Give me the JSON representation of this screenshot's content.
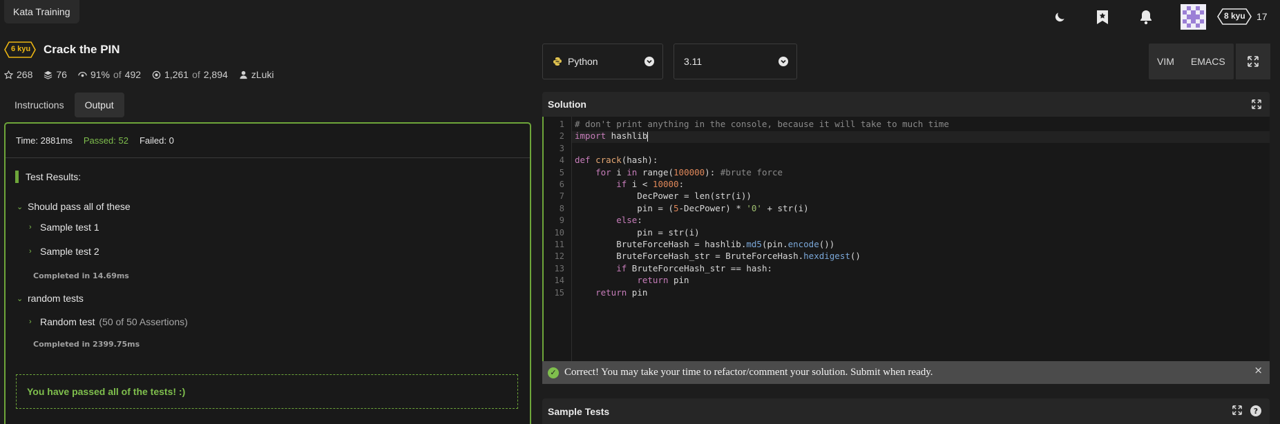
{
  "topbar": {
    "kata_training": "Kata Training",
    "rank": "8 kyu",
    "honor": "17"
  },
  "kata": {
    "kyu": "6 kyu",
    "title": "Crack the PIN",
    "stats": {
      "stars": "268",
      "collections": "76",
      "satisfaction": "91%",
      "satisfaction_of": "of",
      "votes": "492",
      "completed": "1,261",
      "completed_of": "of",
      "attempted": "2,894",
      "author": "zLuki"
    }
  },
  "tabs": [
    "Instructions",
    "Output"
  ],
  "output": {
    "time": "Time: 2881ms",
    "passed": "Passed: 52",
    "failed": "Failed: 0",
    "results_heading": "Test Results:",
    "group1": "Should pass all of these",
    "test1": "Sample test 1",
    "test2": "Sample test 2",
    "group1_completed": "Completed in 14.69ms",
    "group2": "random tests",
    "test3": "Random test",
    "test3_assertions": "(50 of 50 Assertions)",
    "group2_completed": "Completed in 2399.75ms",
    "passed_message": "You have passed all of the tests! :)"
  },
  "toolbar": {
    "language": "Python",
    "version": "3.11",
    "vim": "VIM",
    "emacs": "EMACS"
  },
  "solution": {
    "title": "Solution",
    "line_numbers": [
      "1",
      "2",
      "3",
      "4",
      "5",
      "6",
      "7",
      "8",
      "9",
      "10",
      "11",
      "12",
      "13",
      "14",
      "15"
    ]
  },
  "correct_message": "Correct! You may take your time to refactor/comment your solution. Submit when ready.",
  "sample_tests": {
    "title": "Sample Tests"
  },
  "colors": {
    "accent_green": "#6ea63a",
    "rank_yellow": "#ecb613",
    "background": "#1d1d1d"
  }
}
